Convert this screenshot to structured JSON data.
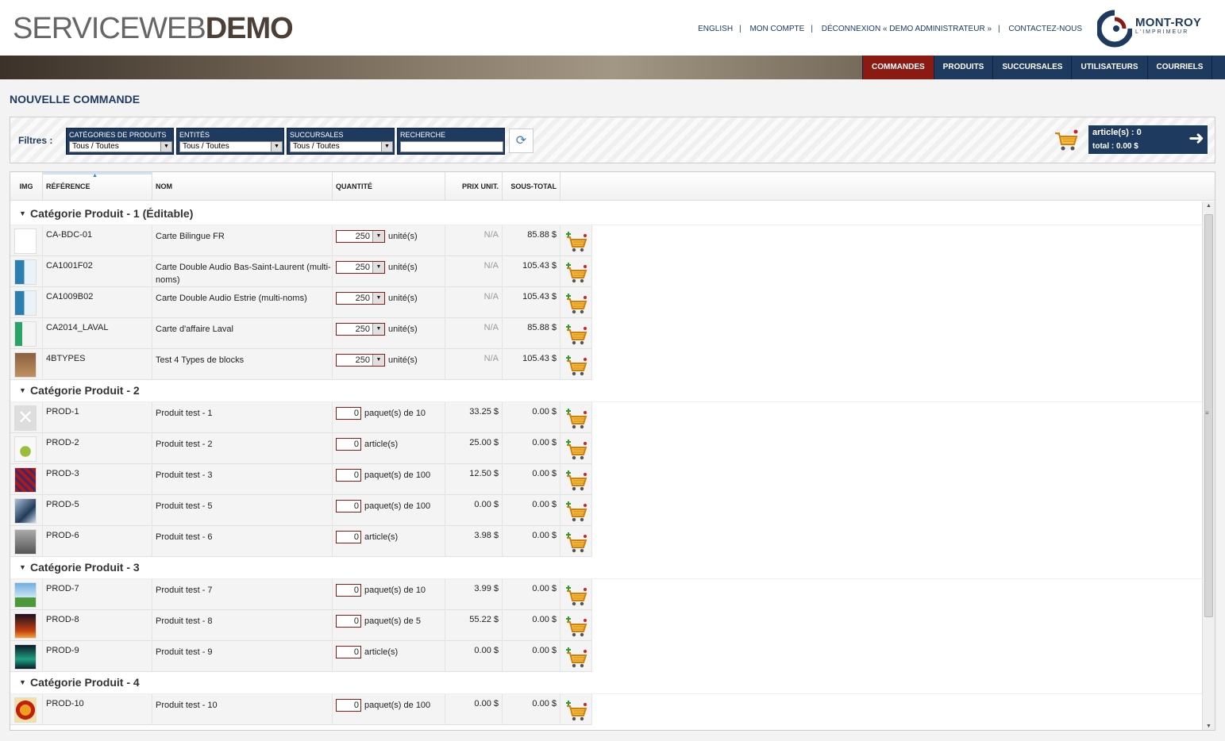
{
  "header": {
    "logo_light": "SERVICEWEB",
    "logo_bold": "DEMO",
    "links": [
      "ENGLISH",
      "MON COMPTE",
      "DÉCONNEXION « DEMO ADMINISTRATEUR »",
      "CONTACTEZ-NOUS"
    ],
    "brand": "MONT-ROY",
    "brand_sub": "L'IMPRIMEUR"
  },
  "nav": {
    "tabs": [
      "COMMANDES",
      "PRODUITS",
      "SUCCURSALES",
      "UTILISATEURS",
      "COURRIELS"
    ],
    "active": "COMMANDES"
  },
  "page_title": "NOUVELLE COMMANDE",
  "filters": {
    "label": "Filtres :",
    "categories": {
      "title": "CATÉGORIES DE PRODUITS",
      "value": "Tous / Toutes"
    },
    "entites": {
      "title": "ENTITÉS",
      "value": "Tous / Toutes"
    },
    "succursales": {
      "title": "SUCCURSALES",
      "value": "Tous / Toutes"
    },
    "recherche": {
      "title": "RECHERCHE",
      "value": ""
    }
  },
  "cart_summary": {
    "articles": "article(s) : 0",
    "total": "total : 0.00 $"
  },
  "columns": [
    "IMG",
    "RÉFÉRENCE",
    "NOM",
    "QUANTITÉ",
    "PRIX UNIT.",
    "SOUS-TOTAL"
  ],
  "groups": [
    {
      "name": "Catégorie Produit - 1 (Éditable)",
      "rows": [
        {
          "ref": "CA-BDC-01",
          "nom": "Carte Bilingue FR",
          "qty": "250",
          "unit": "unité(s)",
          "prix": "N/A",
          "sub": "85.88 $",
          "type": "select",
          "thumb": "card-white"
        },
        {
          "ref": "CA1001F02",
          "nom": "Carte Double Audio Bas-Saint-Laurent (multi-noms)",
          "qty": "250",
          "unit": "unité(s)",
          "prix": "N/A",
          "sub": "105.43 $",
          "type": "select",
          "thumb": "card-blue"
        },
        {
          "ref": "CA1009B02",
          "nom": "Carte Double Audio Estrie (multi-noms)",
          "qty": "250",
          "unit": "unité(s)",
          "prix": "N/A",
          "sub": "105.43 $",
          "type": "select",
          "thumb": "card-blue"
        },
        {
          "ref": "CA2014_LAVAL",
          "nom": "Carte d'affaire Laval",
          "qty": "250",
          "unit": "unité(s)",
          "prix": "N/A",
          "sub": "85.88 $",
          "type": "select",
          "thumb": "card-green"
        },
        {
          "ref": "4BTYPES",
          "nom": "Test 4 Types de blocks",
          "qty": "250",
          "unit": "unité(s)",
          "prix": "N/A",
          "sub": "105.43 $",
          "type": "select",
          "thumb": "brown"
        }
      ]
    },
    {
      "name": "Catégorie Produit - 2",
      "rows": [
        {
          "ref": "PROD-1",
          "nom": "Produit test - 1",
          "qty": "0",
          "unit": "paquet(s) de 10",
          "prix": "33.25 $",
          "sub": "0.00 $",
          "type": "text",
          "thumb": "none"
        },
        {
          "ref": "PROD-2",
          "nom": "Produit test - 2",
          "qty": "0",
          "unit": "article(s)",
          "prix": "25.00 $",
          "sub": "0.00 $",
          "type": "text",
          "thumb": "plant"
        },
        {
          "ref": "PROD-3",
          "nom": "Produit test - 3",
          "qty": "0",
          "unit": "paquet(s) de 100",
          "prix": "12.50 $",
          "sub": "0.00 $",
          "type": "text",
          "thumb": "red"
        },
        {
          "ref": "PROD-5",
          "nom": "Produit test - 5",
          "qty": "0",
          "unit": "paquet(s) de 100",
          "prix": "0.00 $",
          "sub": "0.00 $",
          "type": "text",
          "thumb": "glass"
        },
        {
          "ref": "PROD-6",
          "nom": "Produit test - 6",
          "qty": "0",
          "unit": "article(s)",
          "prix": "3.98 $",
          "sub": "0.00 $",
          "type": "text",
          "thumb": "fog"
        }
      ]
    },
    {
      "name": "Catégorie Produit - 3",
      "rows": [
        {
          "ref": "PROD-7",
          "nom": "Produit test - 7",
          "qty": "0",
          "unit": "paquet(s) de 10",
          "prix": "3.99 $",
          "sub": "0.00 $",
          "type": "text",
          "thumb": "sky"
        },
        {
          "ref": "PROD-8",
          "nom": "Produit test - 8",
          "qty": "0",
          "unit": "paquet(s) de 5",
          "prix": "55.22 $",
          "sub": "0.00 $",
          "type": "text",
          "thumb": "sunset"
        },
        {
          "ref": "PROD-9",
          "nom": "Produit test - 9",
          "qty": "0",
          "unit": "article(s)",
          "prix": "0.00 $",
          "sub": "0.00 $",
          "type": "text",
          "thumb": "aurora"
        }
      ]
    },
    {
      "name": "Catégorie Produit - 4",
      "rows": [
        {
          "ref": "PROD-10",
          "nom": "Produit test - 10",
          "qty": "0",
          "unit": "paquet(s) de 100",
          "prix": "0.00 $",
          "sub": "0.00 $",
          "type": "text",
          "thumb": "leaf"
        }
      ]
    }
  ],
  "colors": {
    "navy": "#1e3a5f",
    "active_tab": "#8b1a12",
    "cart_orange": "#f0a020",
    "plus_green": "#2e9e2e"
  }
}
